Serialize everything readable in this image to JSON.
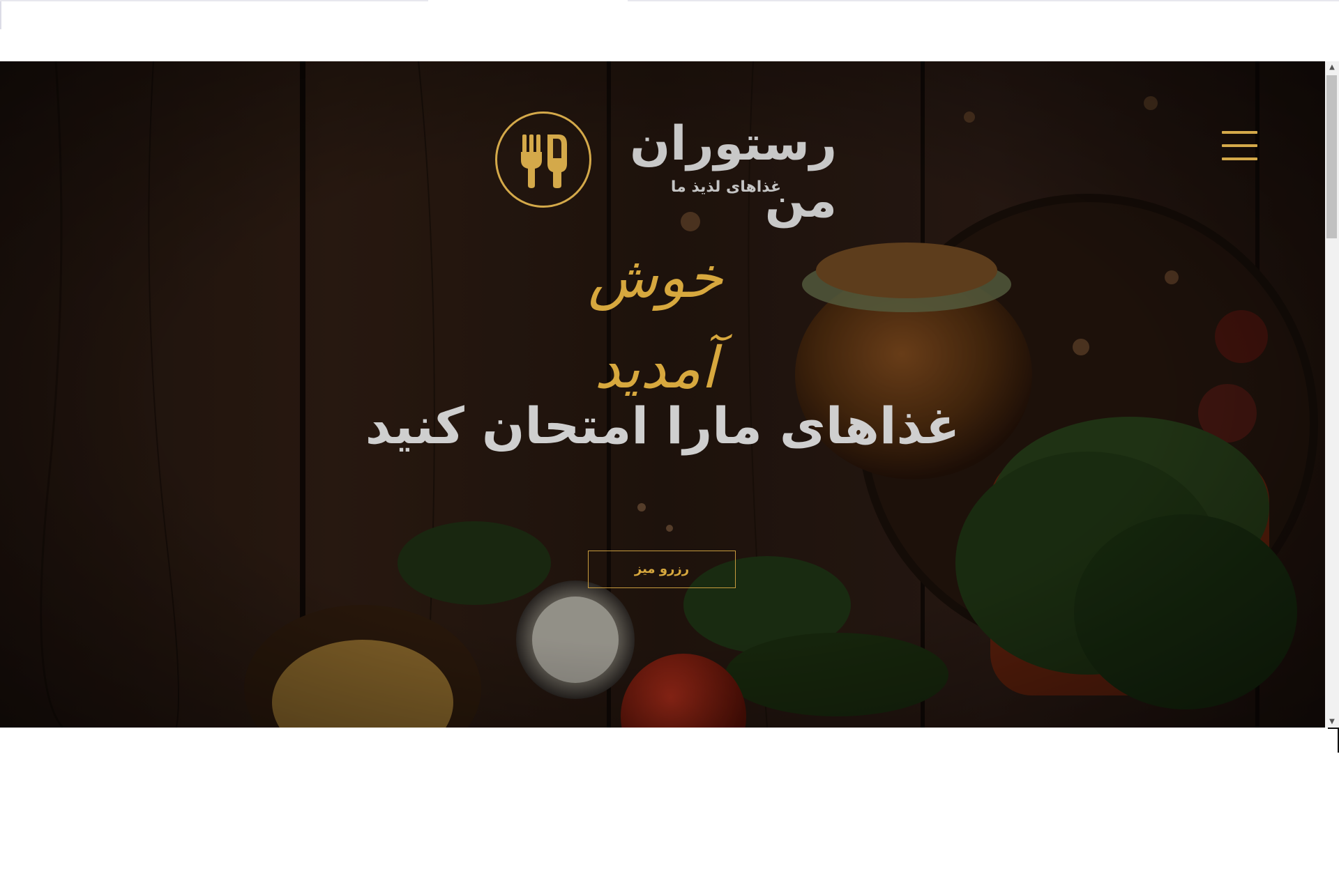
{
  "header": {
    "brand_title": "رستوران من",
    "brand_tagline": "غذاهای لذیذ ما",
    "menu_icon": "hamburger-menu-icon",
    "logo_icon": "fork-knife-icon"
  },
  "hero": {
    "welcome_text": "خوش آمدید",
    "heading": "غذاهای مارا امتحان کنید",
    "reserve_label": "رزرو میز"
  },
  "colors": {
    "accent": "#d4a94a",
    "text_light": "#cfcfcf",
    "background_dark": "#1c120d",
    "page_background": "#ffffff"
  },
  "scrollbar": {
    "up_icon": "arrow-up-icon",
    "down_icon": "arrow-down-icon"
  }
}
